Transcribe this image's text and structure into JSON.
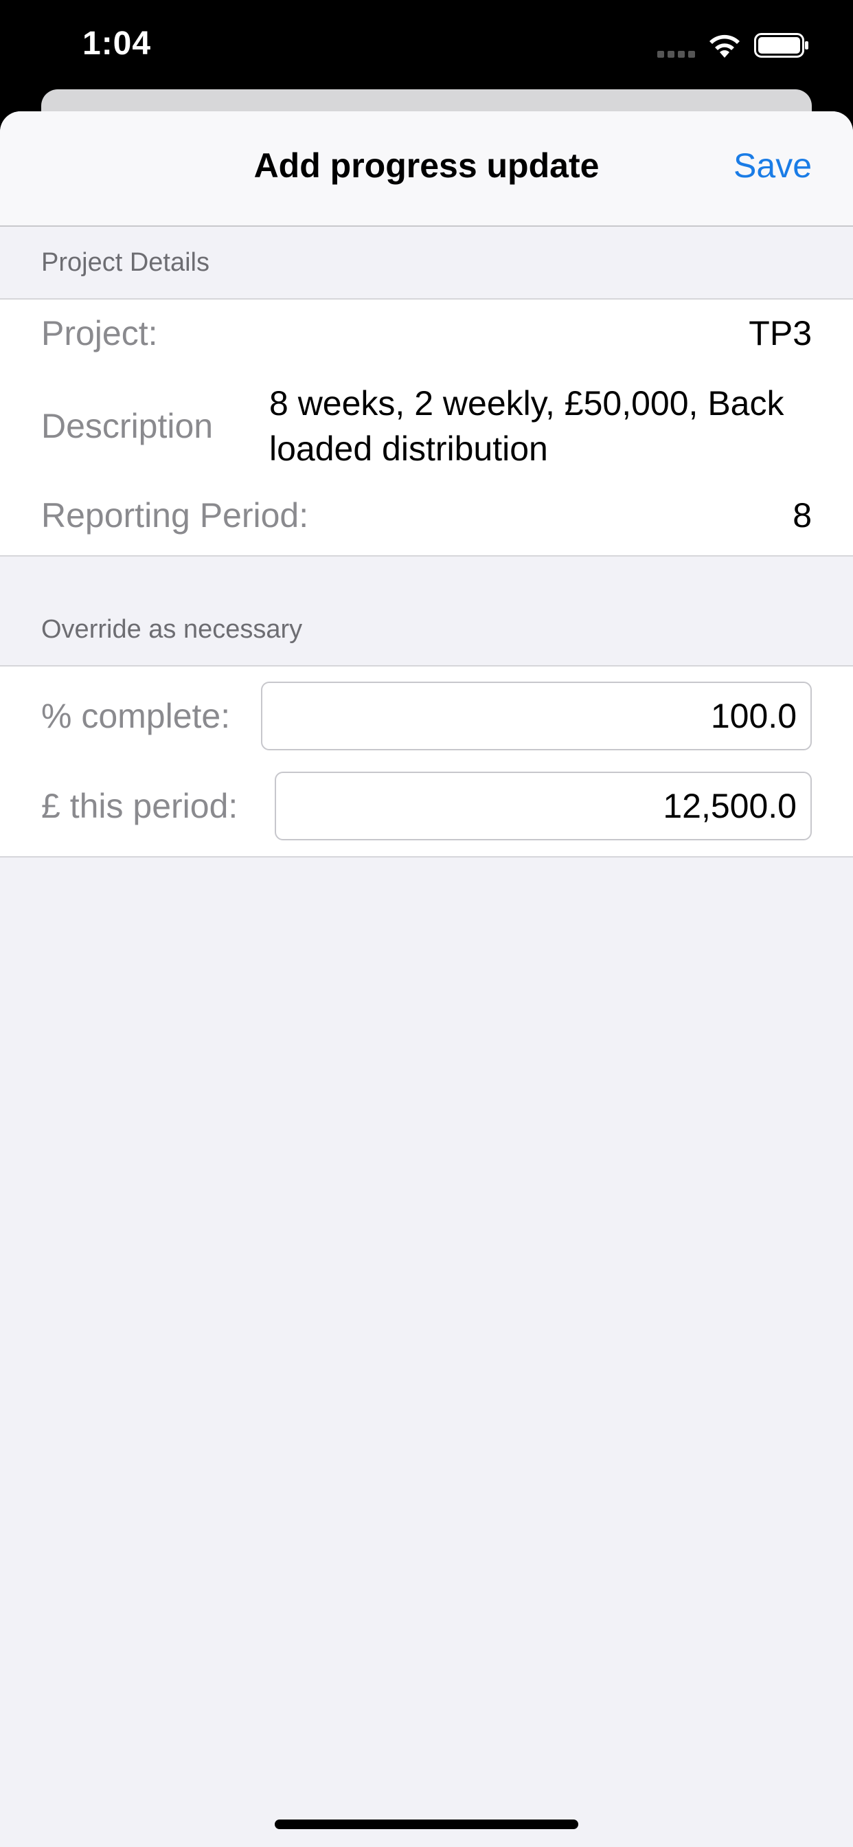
{
  "status_bar": {
    "time": "1:04",
    "icons": [
      "signal-icon",
      "wifi-icon",
      "battery-icon"
    ]
  },
  "nav": {
    "title": "Add progress update",
    "save_label": "Save"
  },
  "project_details": {
    "header": "Project Details",
    "project_label": "Project:",
    "project_value": "TP3",
    "description_label": "Description",
    "description_value": "8 weeks, 2 weekly, £50,000, Back loaded distribution",
    "period_label": "Reporting Period:",
    "period_value": "8"
  },
  "overrides": {
    "header": "Override as necessary",
    "percent_label": "% complete:",
    "percent_value": "100.0",
    "money_label": "£ this period:",
    "money_value": "12,500.0"
  },
  "colors": {
    "accent": "#1a7ce6",
    "background": "#f2f2f7"
  }
}
